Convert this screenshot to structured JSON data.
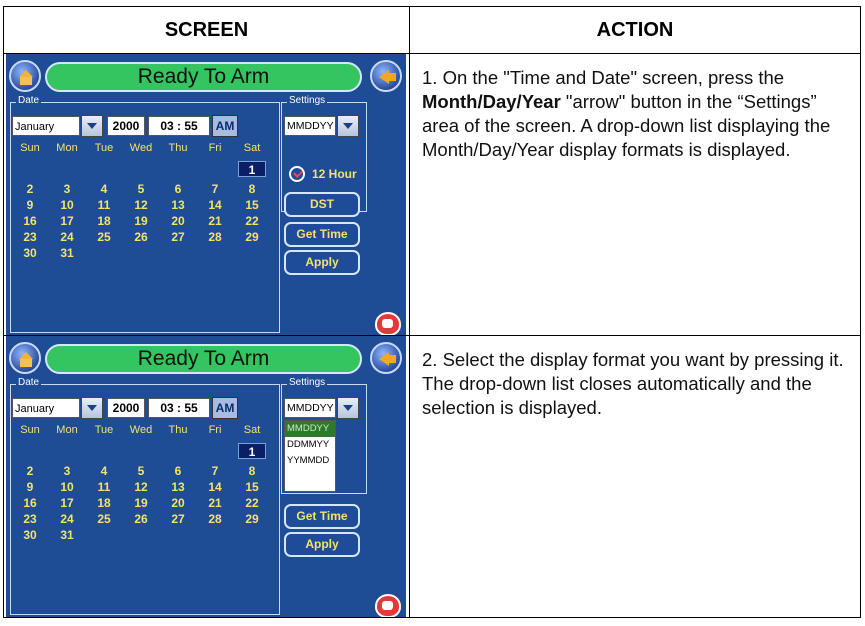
{
  "table": {
    "header_screen": "SCREEN",
    "header_action": "ACTION"
  },
  "device_screen": {
    "status": "Ready To Arm",
    "date_group_label": "Date",
    "settings_group_label": "Settings",
    "month": "January",
    "year": "2000",
    "time": "03 : 55",
    "ampm": "AM",
    "weekdays": [
      "Sun",
      "Mon",
      "Tue",
      "Wed",
      "Thu",
      "Fri",
      "Sat"
    ],
    "calendar_days": [
      [
        null,
        null,
        null,
        null,
        null,
        null,
        "1"
      ],
      [
        "2",
        "3",
        "4",
        "5",
        "6",
        "7",
        "8"
      ],
      [
        "9",
        "10",
        "11",
        "12",
        "13",
        "14",
        "15"
      ],
      [
        "16",
        "17",
        "18",
        "19",
        "20",
        "21",
        "22"
      ],
      [
        "23",
        "24",
        "25",
        "26",
        "27",
        "28",
        "29"
      ],
      [
        "30",
        "31",
        null,
        null,
        null,
        null,
        null
      ]
    ],
    "selected_day": "1",
    "date_format": "MMDDYY",
    "hour_mode_label": "12 Hour",
    "dst_label": "DST",
    "get_time_label": "Get Time",
    "apply_label": "Apply",
    "format_options": [
      "MMDDYY",
      "DDMMYY",
      "YYMMDD"
    ],
    "highlighted_option": "MMDDYY",
    "icons": {
      "home": "house-icon",
      "back": "back-arrow-icon",
      "panic": "alarm-icon",
      "clock": "check-clock-icon"
    },
    "colors": {
      "screen_bg": "#1e4d95",
      "status_bar": "#34c460",
      "day_text": "#f3e36a",
      "list_highlight": "#2d7a2a"
    }
  },
  "rows": [
    {
      "step": "1.",
      "text_before": "On the \"Time and Date\" screen, press the ",
      "bold": "Month/Day/Year",
      "text_after": " \"arrow\" button in the “Settings” area of the screen.  A drop-down list displaying the Month/Day/Year display formats is displayed."
    },
    {
      "step": "2.",
      "text": "Select the display format you want by pressing it.  The drop-down list closes automatically and the selection is displayed."
    }
  ]
}
